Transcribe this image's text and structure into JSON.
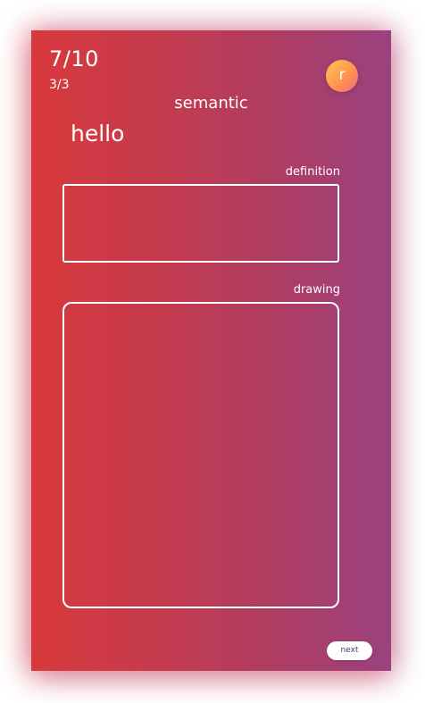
{
  "progress": {
    "score": "7/10",
    "step": "3/3"
  },
  "user": {
    "avatar_letter": "r"
  },
  "mode": {
    "title": "semantic"
  },
  "card": {
    "word": "hello",
    "definition_label": "definition",
    "definition_value": "",
    "drawing_label": "drawing"
  },
  "actions": {
    "next_label": "next"
  },
  "colors": {
    "gradient_start": "#d8393c",
    "gradient_end": "#9a417f",
    "avatar_start": "#ffc35a",
    "avatar_end": "#f5697f",
    "button_text": "#3a3f5c"
  }
}
